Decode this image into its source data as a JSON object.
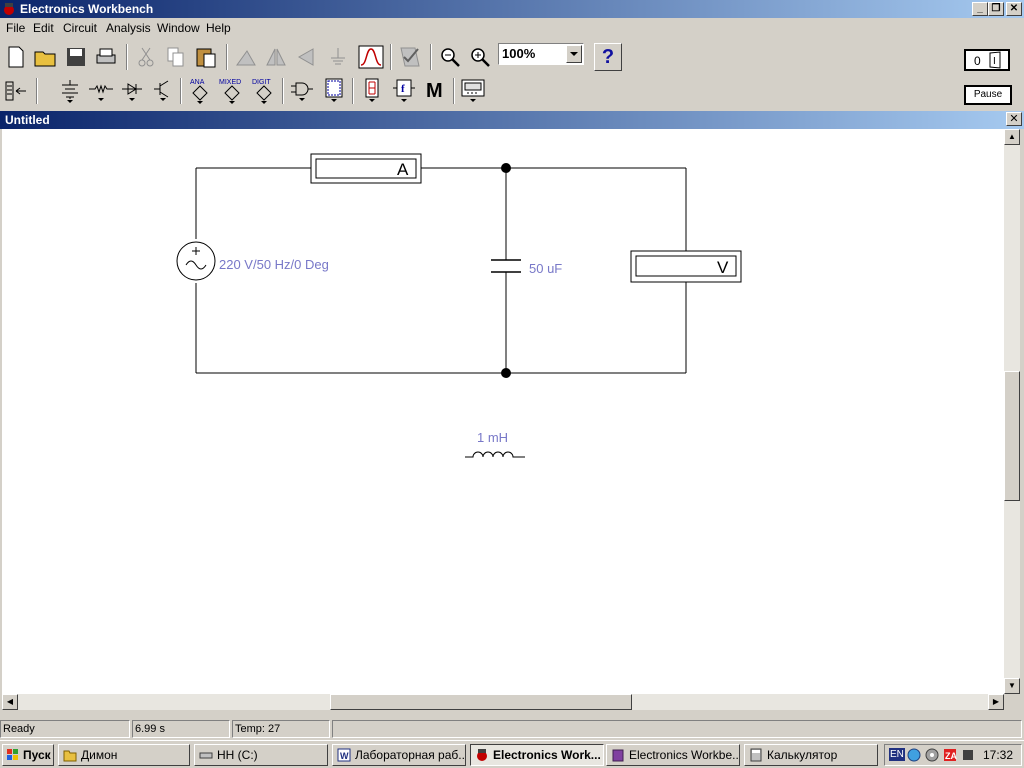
{
  "window": {
    "title": "Electronics Workbench"
  },
  "menu": [
    "File",
    "Edit",
    "Circuit",
    "Analysis",
    "Window",
    "Help"
  ],
  "toolbar": {
    "zoom": "100%",
    "help": "?",
    "pause_label": "Pause",
    "parts_labels": {
      "analog": "ANA",
      "mixed": "MIXED",
      "digital": "DIGIT",
      "function": "f",
      "misc": "M"
    },
    "power_switch": {
      "state": "0"
    }
  },
  "document": {
    "title": "Untitled",
    "close": "✕"
  },
  "circuit": {
    "source_label": "220 V/50 Hz/0 Deg",
    "capacitor_label": "50 uF",
    "inductor_label": "1 mH",
    "ammeter_label": "A",
    "voltmeter_label": "V",
    "component_label_color": "#7878c8"
  },
  "status": {
    "state": "Ready",
    "time": "6.99 s",
    "temp": "Temp:  27"
  },
  "taskbar": {
    "start": "Пуск",
    "tasks": [
      {
        "label": "Димон",
        "icon": "folder-icon"
      },
      {
        "label": "HH (C:)",
        "icon": "drive-icon"
      },
      {
        "label": "Лабораторная раб...",
        "icon": "word-icon"
      },
      {
        "label": "Electronics Work...",
        "icon": "ewb-icon",
        "active": true
      },
      {
        "label": "Electronics Workbe...",
        "icon": "book-icon"
      },
      {
        "label": "Калькулятор",
        "icon": "calculator-icon"
      }
    ],
    "lang": "EN",
    "clock": "17:32"
  }
}
